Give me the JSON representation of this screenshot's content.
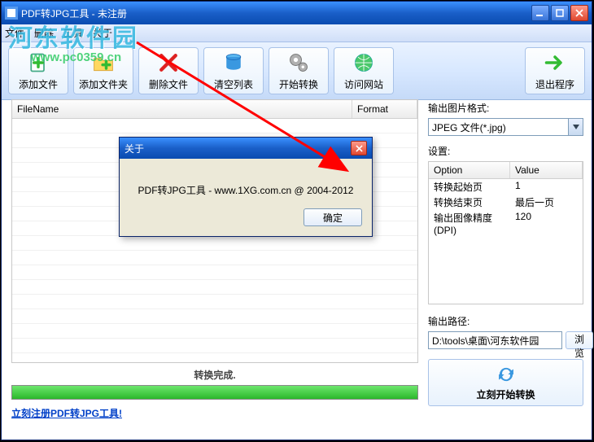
{
  "window": {
    "title": "PDF转JPG工具 - 未注册"
  },
  "menubar": [
    "文件",
    "删除",
    "工具",
    "关于"
  ],
  "toolbar": {
    "add_file": "添加文件",
    "add_folder": "添加文件夹",
    "delete_file": "删除文件",
    "clear_list": "清空列表",
    "start_convert": "开始转换",
    "visit_site": "访问网站",
    "exit": "退出程序"
  },
  "filelist": {
    "col_filename": "FileName",
    "col_format": "Format"
  },
  "status_text": "转换完成.",
  "register_link": "立刻注册PDF转JPG工具!",
  "right": {
    "format_label": "输出图片格式:",
    "format_value": "JPEG 文件(*.jpg)",
    "settings_label": "设置:",
    "col_option": "Option",
    "col_value": "Value",
    "rows": [
      {
        "opt": "转换起始页",
        "val": "1"
      },
      {
        "opt": "转换结束页",
        "val": "最后一页"
      },
      {
        "opt": "输出图像精度(DPI)",
        "val": "120"
      }
    ],
    "outpath_label": "输出路径:",
    "outpath_value": "D:\\tools\\桌面\\河东软件园",
    "browse": "浏览",
    "start_now": "立刻开始转换"
  },
  "dialog": {
    "title": "关于",
    "body": "PDF转JPG工具 - www.1XG.com.cn @ 2004-2012",
    "ok": "确定"
  },
  "watermark": {
    "line1": "河东软件园",
    "line2": "www.pc0359.cn"
  }
}
